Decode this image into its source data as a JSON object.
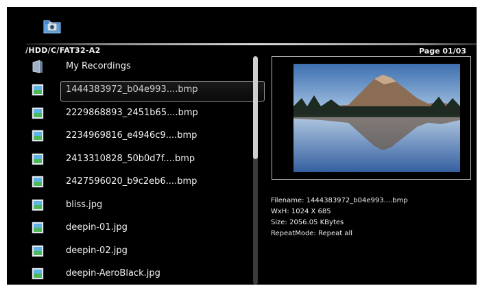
{
  "header": {
    "app_icon": "photo-folder-icon",
    "path": "/HDD/C/FAT32-A2",
    "page": "Page 01/03"
  },
  "file_list": [
    {
      "name": "My Recordings",
      "icon": "folder-icon"
    },
    {
      "name": "1444383972_b04e993....bmp",
      "icon": "image-file-icon",
      "selected": true
    },
    {
      "name": "2229868893_2451b65....bmp",
      "icon": "image-file-icon"
    },
    {
      "name": "2234969816_e4946c9....bmp",
      "icon": "image-file-icon"
    },
    {
      "name": "2413310828_50b0d7f....bmp",
      "icon": "image-file-icon"
    },
    {
      "name": "2427596020_b9c2eb6....bmp",
      "icon": "image-file-icon"
    },
    {
      "name": "bliss.jpg",
      "icon": "image-file-icon"
    },
    {
      "name": "deepin-01.jpg",
      "icon": "image-file-icon"
    },
    {
      "name": "deepin-02.jpg",
      "icon": "image-file-icon"
    },
    {
      "name": "deepin-AeroBlack.jpg",
      "icon": "image-file-icon"
    }
  ],
  "scroll": {
    "position": 0,
    "visible_fraction": 0.45
  },
  "info": {
    "filename": "Filename: 1444383972_b04e993....bmp",
    "dimensions": "WxH: 1024 X 685",
    "size": "Size: 2056.05 KBytes",
    "repeat_mode": "RepeatMode: Repeat all"
  },
  "colors": {
    "background": "#000000",
    "text": "#f2f2f2",
    "accent": "#bdbdbd"
  }
}
